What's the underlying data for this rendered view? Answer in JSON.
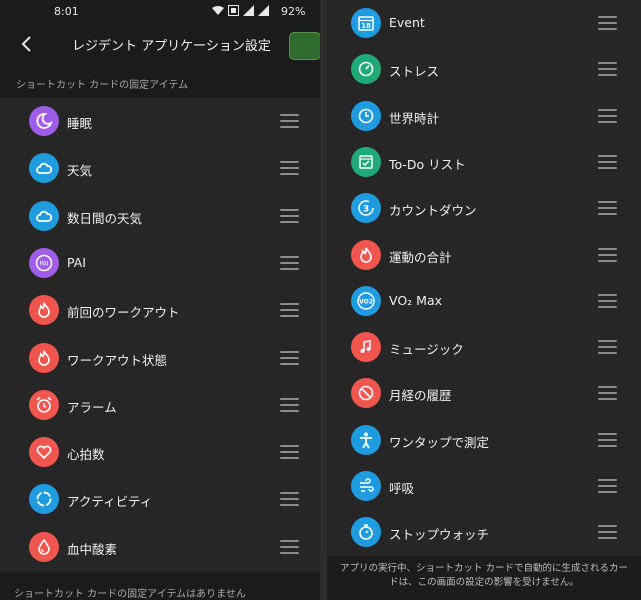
{
  "status": {
    "time": "8:01",
    "battery": "92%"
  },
  "header": {
    "title": "レジデント アプリケーション設定"
  },
  "sections": {
    "fixed_items_label": "ショートカット カードの固定アイテム",
    "no_fixed_items_label": "ショートカット カードの固定アイテムはありません"
  },
  "left_items": [
    {
      "label": "睡眠",
      "icon": "sleep-icon",
      "color": "#a05ee8"
    },
    {
      "label": "天気",
      "icon": "cloud-icon",
      "color": "#1f9be0"
    },
    {
      "label": "数日間の天気",
      "icon": "cloud-icon",
      "color": "#1f9be0"
    },
    {
      "label": "PAI",
      "icon": "pai-icon",
      "color": "#a05ee8"
    },
    {
      "label": "前回のワークアウト",
      "icon": "flame-icon",
      "color": "#f0554e"
    },
    {
      "label": "ワークアウト状態",
      "icon": "flame-icon",
      "color": "#f0554e"
    },
    {
      "label": "アラーム",
      "icon": "alarm-icon",
      "color": "#f0554e"
    },
    {
      "label": "心拍数",
      "icon": "heart-icon",
      "color": "#f0554e"
    },
    {
      "label": "アクティビティ",
      "icon": "activity-ring-icon",
      "color": "#1f9be0"
    },
    {
      "label": "血中酸素",
      "icon": "blood-drop-icon",
      "color": "#f0554e"
    }
  ],
  "right_items": [
    {
      "label": "Event",
      "icon": "calendar-icon",
      "color": "#1f9be0",
      "glyph": "18"
    },
    {
      "label": "ストレス",
      "icon": "stress-gauge-icon",
      "color": "#1faa78"
    },
    {
      "label": "世界時計",
      "icon": "clock-icon",
      "color": "#1f9be0"
    },
    {
      "label": "To-Do リスト",
      "icon": "checklist-icon",
      "color": "#1faa78"
    },
    {
      "label": "カウントダウン",
      "icon": "countdown-icon",
      "color": "#1f9be0",
      "glyph": "3"
    },
    {
      "label": "運動の合計",
      "icon": "flame-icon",
      "color": "#f0554e"
    },
    {
      "label": "VO₂ Max",
      "icon": "vo2-icon",
      "color": "#1f9be0",
      "glyph": "VO2"
    },
    {
      "label": "ミュージック",
      "icon": "music-note-icon",
      "color": "#f0554e"
    },
    {
      "label": "月経の履歴",
      "icon": "cycle-icon",
      "color": "#f0554e"
    },
    {
      "label": "ワンタップで測定",
      "icon": "person-icon",
      "color": "#1f9be0"
    },
    {
      "label": "呼吸",
      "icon": "breath-icon",
      "color": "#1f9be0"
    },
    {
      "label": "ストップウォッチ",
      "icon": "stopwatch-icon",
      "color": "#1f9be0"
    }
  ],
  "footer": {
    "note": "アプリの実行中、ショートカット カードで自動的に生成されるカードは、この画面の設定の影響を受けません。"
  }
}
